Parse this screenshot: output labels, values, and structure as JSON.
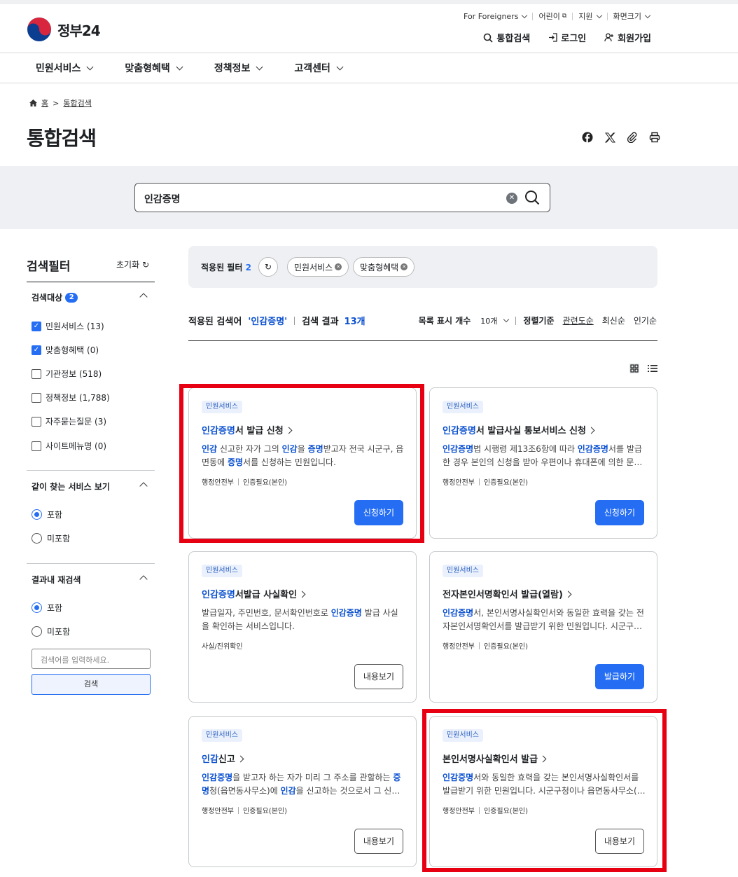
{
  "header": {
    "logo_text": "정부",
    "logo_num": "24",
    "util": [
      "For Foreigners",
      "어린이",
      "지원",
      "화면크기"
    ],
    "actions": [
      "통합검색",
      "로그인",
      "회원가입"
    ],
    "nav": [
      "민원서비스",
      "맞춤형혜택",
      "정책정보",
      "고객센터"
    ]
  },
  "breadcrumb": {
    "home": "홈",
    "current": "통합검색"
  },
  "page_title": "통합검색",
  "search": {
    "value": "인감증명"
  },
  "filter": {
    "title": "검색필터",
    "reset": "초기화",
    "target_label": "검색대상",
    "target_count": "2",
    "options": [
      {
        "label": "민원서비스 (13)",
        "checked": true
      },
      {
        "label": "맞춤형혜택 (0)",
        "checked": true
      },
      {
        "label": "기관정보 (518)",
        "checked": false
      },
      {
        "label": "정책정보 (1,788)",
        "checked": false
      },
      {
        "label": "자주묻는질문 (3)",
        "checked": false
      },
      {
        "label": "사이트메뉴명 (0)",
        "checked": false
      }
    ],
    "together_label": "같이 찾는 서비스 보기",
    "together_opts": [
      "포함",
      "미포함"
    ],
    "research_label": "결과내 재검색",
    "research_opts": [
      "포함",
      "미포함"
    ],
    "research_placeholder": "검색어를 입력하세요.",
    "research_button": "검색"
  },
  "applied": {
    "label": "적용된 필터",
    "count": "2",
    "chips": [
      "민원서비스",
      "맞춤형혜택"
    ]
  },
  "result": {
    "query_label": "적용된 검색어",
    "query": "'인감증명'",
    "count_label": "검색 결과",
    "count": "13개",
    "size_label": "목록 표시 개수",
    "size_value": "10개",
    "sort_label": "정렬기준",
    "sort_opts": [
      "관련도순",
      "최신순",
      "인기순"
    ]
  },
  "cards": [
    {
      "tag": "민원서비스",
      "title_hl": "인감증명",
      "title_rest": "서 발급 신청",
      "desc": [
        [
          "hl",
          "인감"
        ],
        [
          "t",
          " 신고한 자가 그의 "
        ],
        [
          "hl",
          "인감"
        ],
        [
          "t",
          "을 "
        ],
        [
          "hl",
          "증명"
        ],
        [
          "t",
          "받고자 전국 시군구, 읍면동에 "
        ],
        [
          "hl",
          "증명"
        ],
        [
          "t",
          "서를 신청하는 민원입니다."
        ]
      ],
      "meta": [
        "행정안전부",
        "인증필요(본인)"
      ],
      "button": "신청하기",
      "primary": true
    },
    {
      "tag": "민원서비스",
      "title_hl": "인감증명",
      "title_rest": "서 발급사실 통보서비스 신청",
      "desc": [
        [
          "hl",
          "인감증명"
        ],
        [
          "t",
          "법 시행령 제13조6항에 따라 "
        ],
        [
          "hl",
          "인감증명"
        ],
        [
          "t",
          "서를 발급한 경우 본인의 신청을 받아 우편이나 휴대폰에 의한 문…"
        ]
      ],
      "meta": [
        "행정안전부",
        "인증필요(본인)"
      ],
      "button": "신청하기",
      "primary": true
    },
    {
      "tag": "민원서비스",
      "title_hl": "인감증명",
      "title_rest": "서발급 사실확인",
      "desc": [
        [
          "t",
          "발급일자, 주민번호, 문서확인번호로 "
        ],
        [
          "hl",
          "인감증명"
        ],
        [
          "t",
          " 발급 사실을 확인하는 서비스입니다."
        ]
      ],
      "meta": [
        "사실/진위확인"
      ],
      "button": "내용보기",
      "primary": false
    },
    {
      "tag": "민원서비스",
      "title_hl": "",
      "title_rest": "전자본인서명확인서 발급(열람)",
      "desc": [
        [
          "hl",
          "인감증명"
        ],
        [
          "t",
          "서, 본인서명사실확인서와 동일한 효력을 갖는 전자본인서명확인서를 발급받기 위한 민원입니다. 시군구…"
        ]
      ],
      "meta": [
        "행정안전부",
        "인증필요(본인)"
      ],
      "button": "발급하기",
      "primary": true
    },
    {
      "tag": "민원서비스",
      "title_hl": "인감",
      "title_rest": "신고",
      "desc": [
        [
          "hl",
          "인감증명"
        ],
        [
          "t",
          "을 받고자 하는 자가 미리 그 주소를 관할하는 "
        ],
        [
          "hl",
          "증명"
        ],
        [
          "t",
          "청(읍면동사무소)에 "
        ],
        [
          "hl",
          "인감"
        ],
        [
          "t",
          "을 신고하는 것으로서 그 신…"
        ]
      ],
      "meta": [
        "행정안전부",
        "인증필요(본인)"
      ],
      "button": "내용보기",
      "primary": false
    },
    {
      "tag": "민원서비스",
      "title_hl": "",
      "title_rest": "본인서명사실확인서 발급",
      "desc": [
        [
          "hl",
          "인감증명"
        ],
        [
          "t",
          "서와 동일한 효력을 갖는 본인서명사실확인서를 발급받기 위한 민원입니다. 시군구청이나 읍면동사무소(…"
        ]
      ],
      "meta": [
        "행정안전부",
        "인증필요(본인)"
      ],
      "button": "내용보기",
      "primary": false
    }
  ],
  "colors": {
    "accent": "#256ef4",
    "highlight": "#0b50d0",
    "annotation": "#e60012"
  }
}
